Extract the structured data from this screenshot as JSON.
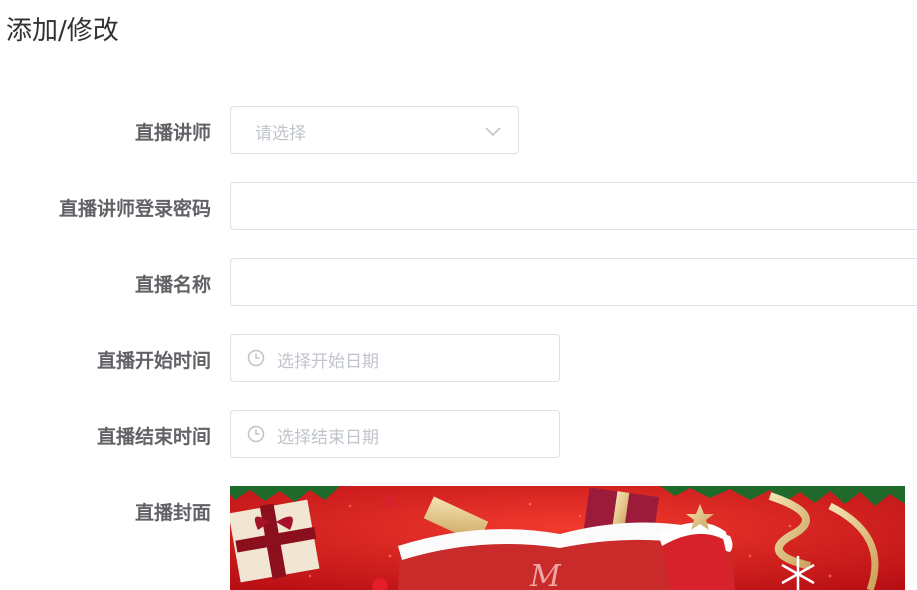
{
  "page": {
    "title": "添加/修改"
  },
  "form": {
    "teacher": {
      "label": "直播讲师",
      "placeholder": "请选择"
    },
    "password": {
      "label": "直播讲师登录密码",
      "value": ""
    },
    "name": {
      "label": "直播名称",
      "value": ""
    },
    "start_time": {
      "label": "直播开始时间",
      "placeholder": "选择开始日期"
    },
    "end_time": {
      "label": "直播结束时间",
      "placeholder": "选择结束日期"
    },
    "cover": {
      "label": "直播封面"
    }
  },
  "colors": {
    "border": "#dcdfe6",
    "placeholder": "#c0c4cc",
    "label": "#606266",
    "cover_red": "#d4161c"
  }
}
